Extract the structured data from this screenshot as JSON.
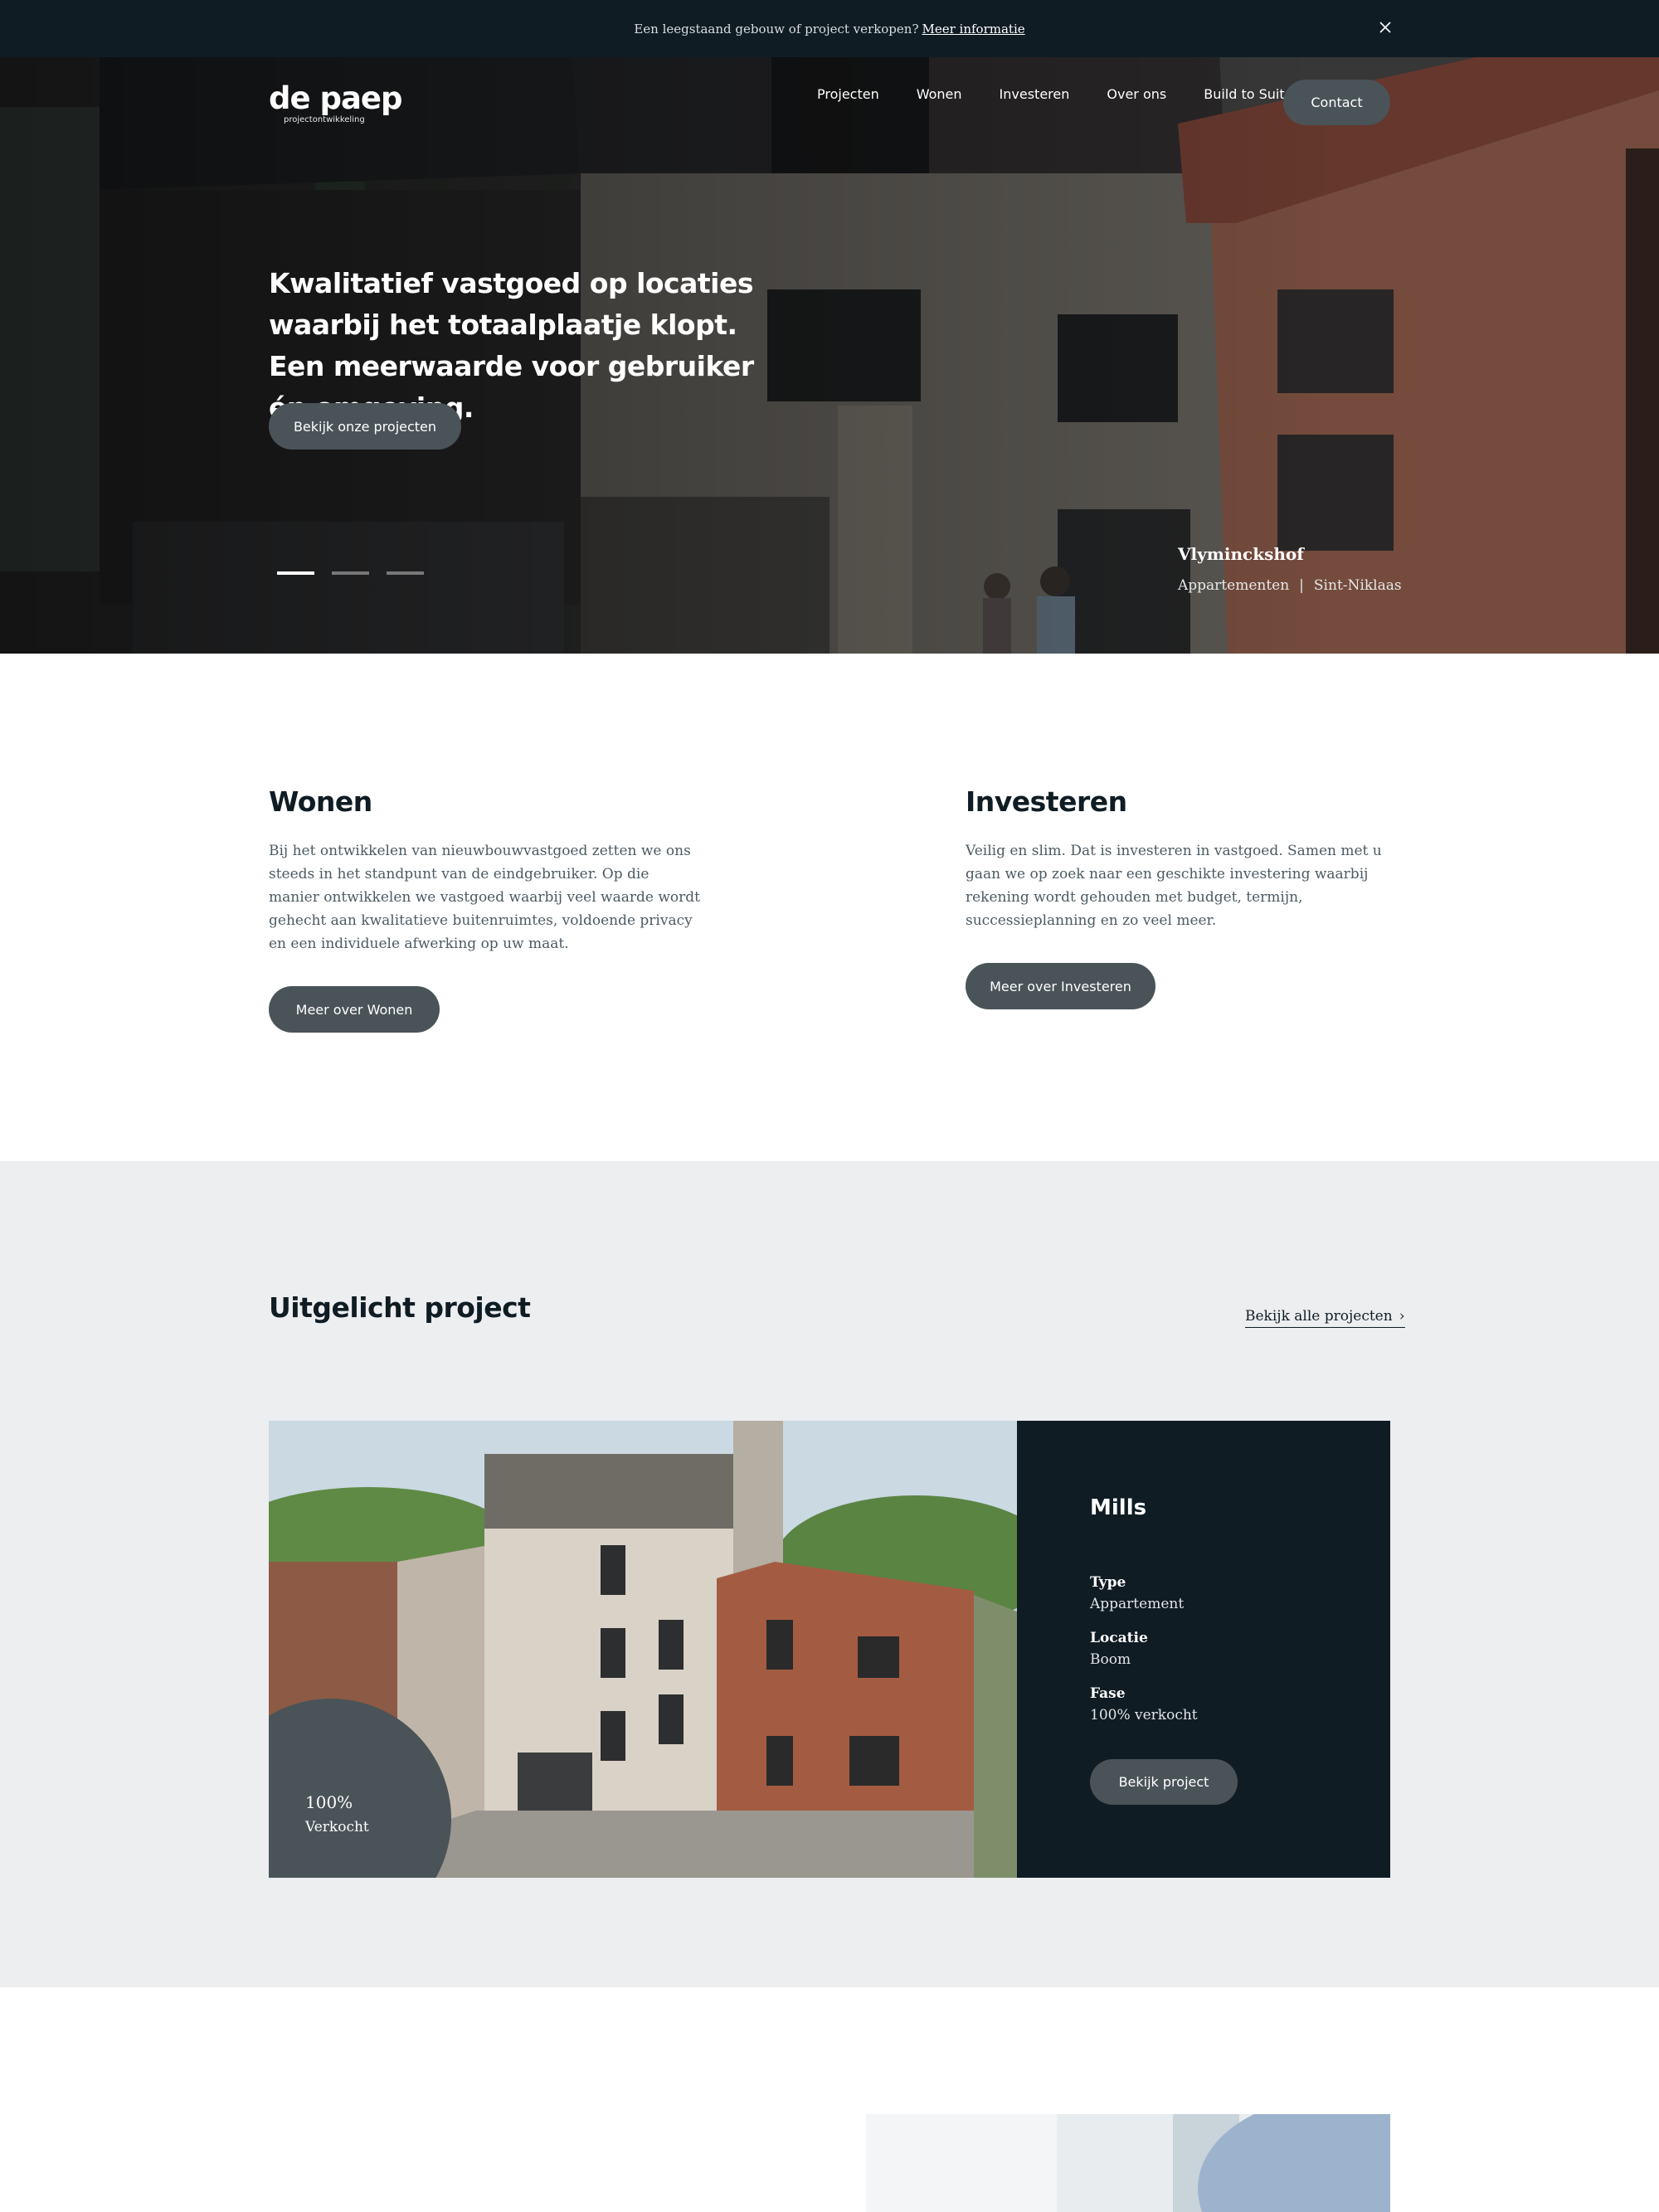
{
  "announcement": {
    "text": "Een leegstaand gebouw of project verkopen?",
    "link": "Meer informatie",
    "close_icon": "close-icon"
  },
  "logo": {
    "word": "de paep",
    "sub": "projectontwikkeling"
  },
  "nav": {
    "items": [
      "Projecten",
      "Wonen",
      "Investeren",
      "Over ons",
      "Build to Suit"
    ],
    "contact": "Contact"
  },
  "hero": {
    "heading": "Kwalitatief vastgoed op locaties waarbij het totaalplaatje klopt. Een meerwaarde voor gebruiker én omgeving.",
    "cta": "Bekijk onze projecten",
    "slides": 3,
    "active_slide": 1,
    "caption": {
      "name": "Vlyminckshof",
      "type": "Appartementen",
      "separator": "|",
      "city": "Sint-Niklaas"
    }
  },
  "wonen": {
    "title": "Wonen",
    "text": "Bij het ontwikkelen van nieuwbouwvastgoed zetten we ons steeds in het standpunt van de eindgebruiker. Op die manier ontwikkelen we vastgoed waarbij veel waarde wordt gehecht aan kwalitatieve buitenruimtes, voldoende privacy en een individuele afwerking op uw maat.",
    "button": "Meer over Wonen"
  },
  "investeren": {
    "title": "Investeren",
    "text": "Veilig en slim. Dat is investeren in vastgoed. Samen met u gaan we op zoek naar een geschikte investering waarbij rekening wordt gehouden met budget, termijn, successieplanning en zo veel meer.",
    "button": "Meer over Investeren"
  },
  "featured": {
    "title": "Uitgelicht project",
    "all_link": "Bekijk alle projecten",
    "chevron": "›",
    "project": {
      "name": "Mills",
      "badge_pct": "100%",
      "badge_label": "Verkocht",
      "type_label": "Type",
      "type": "Appartement",
      "location_label": "Locatie",
      "location": "Boom",
      "phase_label": "Fase",
      "phase": "100% verkocht",
      "button": "Bekijk project"
    }
  },
  "colors": {
    "dark": "#0f1c24",
    "button": "#4a5358",
    "section_bg": "#edeef0"
  }
}
